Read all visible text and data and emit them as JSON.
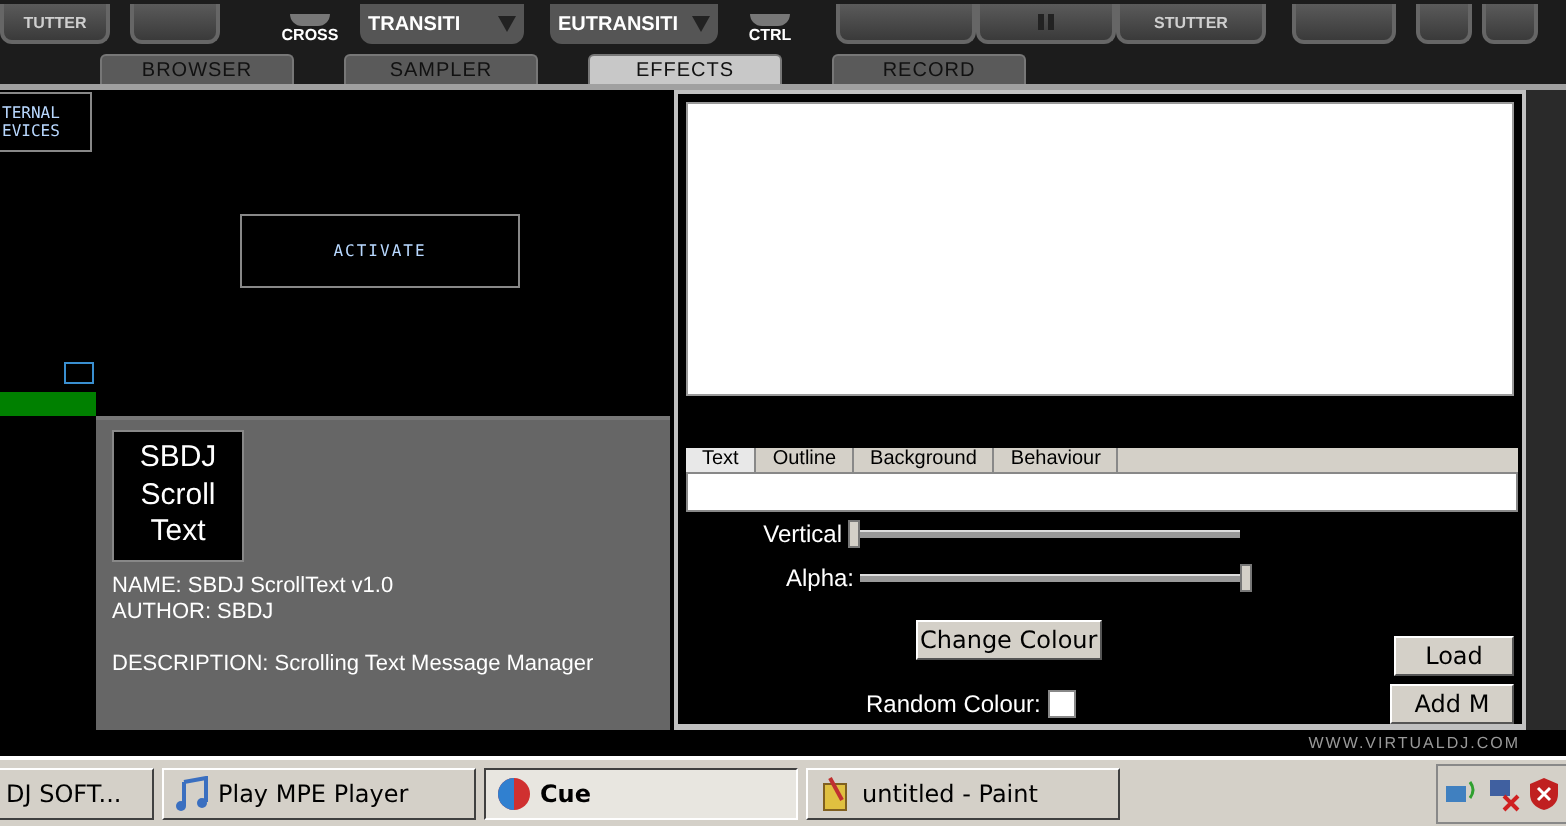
{
  "top_controls": [
    {
      "kind": "button",
      "label": "TUTTER"
    },
    {
      "kind": "button"
    },
    {
      "kind": "knob",
      "caption": "CROSS"
    },
    {
      "kind": "dropdown",
      "value": "TRANSITI"
    },
    {
      "kind": "dropdown",
      "value": "EUTRANSITI"
    },
    {
      "kind": "knob",
      "caption": "CTRL"
    },
    {
      "kind": "button"
    },
    {
      "kind": "pause"
    },
    {
      "kind": "button",
      "label": "STUTTER"
    },
    {
      "kind": "button"
    },
    {
      "kind": "small"
    },
    {
      "kind": "small"
    }
  ],
  "tabs": [
    {
      "label": "BROWSER",
      "selected": false
    },
    {
      "label": "SAMPLER",
      "selected": false
    },
    {
      "label": "EFFECTS",
      "selected": true
    },
    {
      "label": "RECORD",
      "selected": false
    }
  ],
  "devices_button": {
    "lines": [
      "TERNAL",
      "EVICES"
    ]
  },
  "activate_button": {
    "label": "ACTIVATE"
  },
  "plugin": {
    "logo": [
      "SBDJ",
      "Scroll",
      "Text"
    ],
    "name": "NAME: SBDJ ScrollText v1.0",
    "author": "AUTHOR: SBDJ",
    "description": "DESCRIPTION: Scrolling Text Message Manager"
  },
  "config": {
    "tabs": [
      {
        "label": "Text",
        "selected": true
      },
      {
        "label": "Outline",
        "selected": false
      },
      {
        "label": "Background",
        "selected": false
      },
      {
        "label": "Behaviour",
        "selected": false
      }
    ],
    "sliders": [
      {
        "label": "Vertical",
        "level": 0.0
      },
      {
        "label": "Alpha:",
        "level": 1.0
      }
    ],
    "change_colour": "Change Colour",
    "random_colour": {
      "label": "Random Colour:",
      "checked": false
    },
    "side_buttons": [
      "Load",
      "Add M"
    ]
  },
  "footer_url": "WWW.VIRTUALDJ.COM",
  "taskbar": [
    {
      "label": "DJ SOFT...",
      "selected": false
    },
    {
      "label": "Play MPE Player",
      "selected": false
    },
    {
      "label": "Cue",
      "selected": true
    },
    {
      "label": "untitled - Paint",
      "selected": false
    }
  ]
}
